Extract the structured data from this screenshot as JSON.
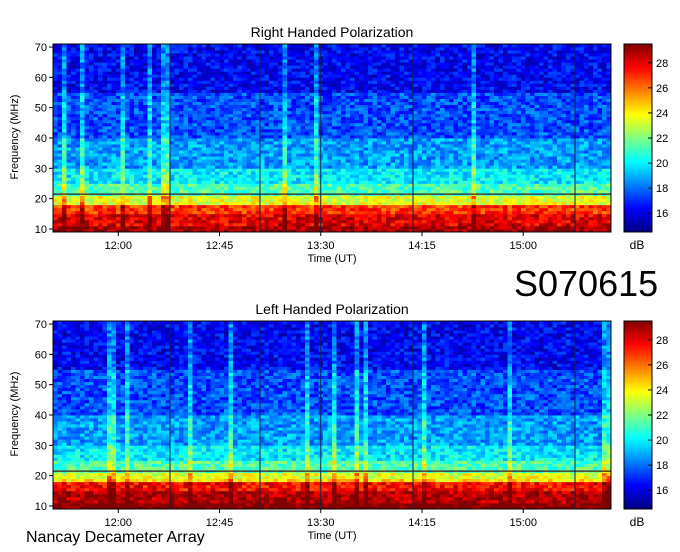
{
  "observation_id": "S070615",
  "footer_label": "Nancay Decameter Array",
  "colors": {
    "colormap": [
      "#00007f",
      "#0000ff",
      "#0080ff",
      "#00ffff",
      "#80ff80",
      "#ffff00",
      "#ff8000",
      "#ff0000",
      "#7f0000"
    ]
  },
  "chart_data": [
    {
      "type": "heatmap",
      "title": "Right Handed Polarization",
      "xlabel": "Time (UT)",
      "ylabel": "Frequency (MHz)",
      "x_ticks": [
        "12:00",
        "12:45",
        "13:30",
        "14:15",
        "15:00"
      ],
      "x_tick_minutes": [
        720,
        765,
        810,
        855,
        900
      ],
      "xlim_minutes": [
        691,
        939
      ],
      "y_ticks": [
        10,
        20,
        30,
        40,
        50,
        60,
        70
      ],
      "ylim": [
        9,
        71
      ],
      "colorbar": {
        "label": "dB",
        "ticks": [
          16,
          18,
          20,
          22,
          24,
          26,
          28
        ],
        "range": [
          14.5,
          29.5
        ]
      }
    },
    {
      "type": "heatmap",
      "title": "Left Handed Polarization",
      "xlabel": "Time (UT)",
      "ylabel": "Frequency (MHz)",
      "x_ticks": [
        "12:00",
        "12:45",
        "13:30",
        "14:15",
        "15:00"
      ],
      "x_tick_minutes": [
        720,
        765,
        810,
        855,
        900
      ],
      "xlim_minutes": [
        691,
        939
      ],
      "y_ticks": [
        10,
        20,
        30,
        40,
        50,
        60,
        70
      ],
      "ylim": [
        9,
        71
      ],
      "colorbar": {
        "label": "dB",
        "ticks": [
          16,
          18,
          20,
          22,
          24,
          26,
          28
        ],
        "range": [
          14.5,
          29.5
        ]
      }
    }
  ]
}
